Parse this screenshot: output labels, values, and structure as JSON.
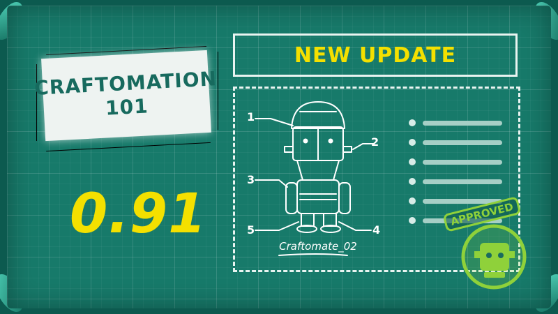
{
  "title_card": {
    "line1": "CRAFTOMATION",
    "line2": "101"
  },
  "version": "0.91",
  "banner": "NEW UPDATE",
  "blueprint": {
    "robot_caption": "Craftomate_02",
    "callouts": [
      "1",
      "2",
      "3",
      "4",
      "5"
    ],
    "bullet_count": 6
  },
  "stamp": {
    "label": "APPROVED"
  },
  "colors": {
    "board": "#177a6a",
    "accent_yellow": "#f4e000",
    "stamp_green": "#8fd13a",
    "line_white": "#e9f4f1"
  }
}
